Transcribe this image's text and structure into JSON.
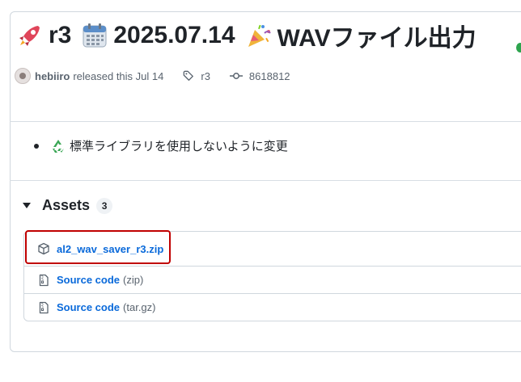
{
  "release": {
    "tag_name": "r3",
    "date": "2025.07.14",
    "title_suffix": "WAVファイル出力",
    "author": "hebiiro",
    "released_text": "released this Jul 14",
    "tag": "r3",
    "commit": "8618812"
  },
  "notes": {
    "items": [
      {
        "text": "標準ライブラリを使用しないように変更"
      }
    ]
  },
  "assets": {
    "title": "Assets",
    "count": "3",
    "items": [
      {
        "name": "al2_wav_saver_r3.zip",
        "suffix": ""
      },
      {
        "name": "Source code",
        "suffix": "(zip)"
      },
      {
        "name": "Source code",
        "suffix": "(tar.gz)"
      }
    ]
  },
  "icons": {
    "tag_emoji": "rocket-icon",
    "calendar_emoji": "calendar-icon",
    "party_emoji": "party-popper-icon",
    "recycle_emoji": "recycle-icon"
  },
  "colors": {
    "link": "#0969da",
    "highlight": "#c00000",
    "muted": "#59636e",
    "border": "#d0d7de"
  }
}
